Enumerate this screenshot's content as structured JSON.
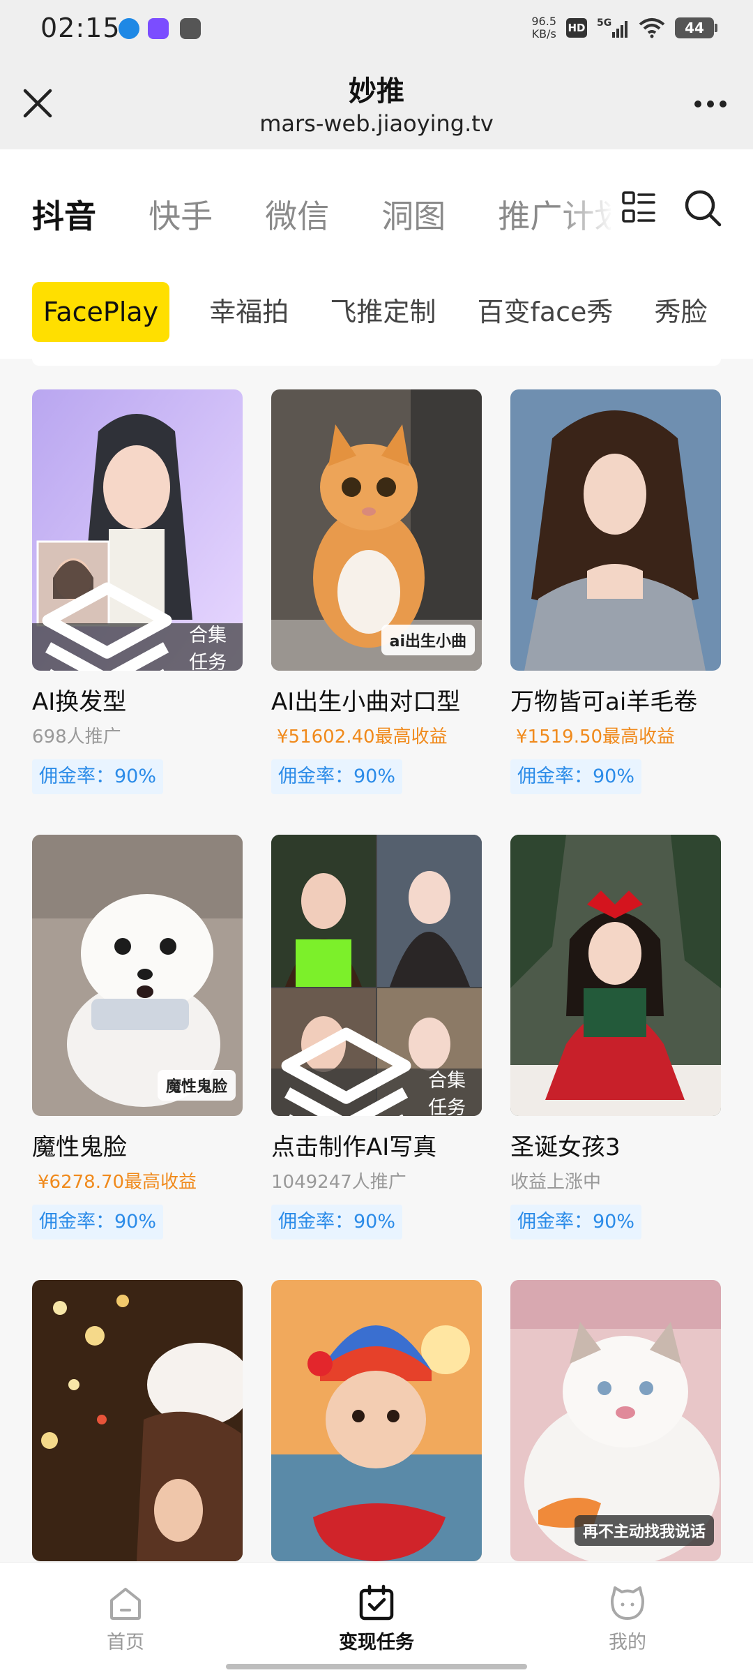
{
  "status_bar": {
    "time": "02:15",
    "net_speed_value": "96.5",
    "net_speed_unit": "KB/s",
    "hd": "HD",
    "signal": "5G",
    "battery": "44"
  },
  "title_bar": {
    "title": "妙推",
    "subtitle": "mars-web.jiaoying.tv"
  },
  "platform_tabs": [
    "抖音",
    "快手",
    "微信",
    "洞图",
    "推广计划"
  ],
  "app_chips": [
    "FacePlay",
    "幸福拍",
    "飞推定制",
    "百变face秀",
    "秀脸"
  ],
  "cards": [
    {
      "title": "AI换发型",
      "sub": "698人推广",
      "rate": "佣金率：90%",
      "collection": "合集任务"
    },
    {
      "title": "AI出生小曲对口型",
      "sub": "¥51602.40最高收益",
      "rate": "佣金率：90%",
      "badge": "ai出生小曲"
    },
    {
      "title": "万物皆可ai羊毛卷",
      "sub": "¥1519.50最高收益",
      "rate": "佣金率：90%"
    },
    {
      "title": "魔性鬼脸",
      "sub": "¥6278.70最高收益",
      "rate": "佣金率：90%",
      "badge": "魔性鬼脸"
    },
    {
      "title": "点击制作AI写真",
      "sub": "1049247人推广",
      "rate": "佣金率：90%",
      "collection": "合集任务"
    },
    {
      "title": "圣诞女孩3",
      "sub": "收益上涨中",
      "rate": "佣金率：90%"
    },
    {},
    {},
    {
      "badge": "再不主动找我说话"
    }
  ],
  "bottom_nav": {
    "home": "首页",
    "tasks": "变现任务",
    "mine": "我的"
  },
  "colors": {
    "accent_yellow": "#ffdf00",
    "earn_orange": "#f08a1c",
    "rate_blue": "#2b8be8"
  }
}
